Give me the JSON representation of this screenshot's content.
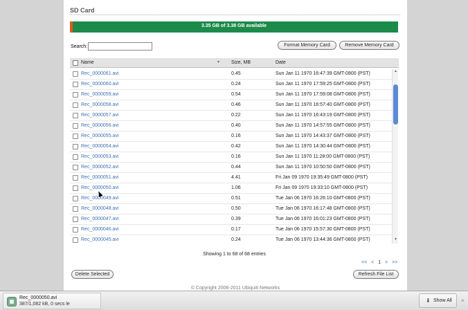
{
  "sd_card": {
    "title": "SD Card",
    "capacity_text": "3.35 GB of 3.38 GB available",
    "capacity_used_fraction": 0.009
  },
  "search": {
    "label": "Search:",
    "value": ""
  },
  "buttons": {
    "format": "Format Memory Card",
    "remove": "Remove Memory Card",
    "delete": "Delete Selected",
    "refresh": "Refresh File List"
  },
  "table": {
    "headers": {
      "name": "Name",
      "size": "Size, MB",
      "date": "Date"
    },
    "rows": [
      {
        "name": "Rec_0000061.avi",
        "size": "0.45",
        "date": "Sun Jan 11 1970 16:47:39 GMT-0800 (PST)"
      },
      {
        "name": "Rec_0000060.avi",
        "size": "0.24",
        "date": "Sun Jan 11 1970 17:59:25 GMT-0800 (PST)"
      },
      {
        "name": "Rec_0000059.avi",
        "size": "0.54",
        "date": "Sun Jan 11 1970 17:59:08 GMT-0800 (PST)"
      },
      {
        "name": "Rec_0000058.avi",
        "size": "0.46",
        "date": "Sun Jan 11 1970 16:57:40 GMT-0800 (PST)"
      },
      {
        "name": "Rec_0000057.avi",
        "size": "0.22",
        "date": "Sun Jan 11 1970 16:43:19 GMT-0800 (PST)"
      },
      {
        "name": "Rec_0000056.avi",
        "size": "0.40",
        "date": "Sun Jan 11 1970 14:57:55 GMT-0800 (PST)"
      },
      {
        "name": "Rec_0000055.avi",
        "size": "0.16",
        "date": "Sun Jan 11 1970 14:43:37 GMT-0800 (PST)"
      },
      {
        "name": "Rec_0000054.avi",
        "size": "0.42",
        "date": "Sun Jan 11 1970 14:30:44 GMT-0800 (PST)"
      },
      {
        "name": "Rec_0000053.avi",
        "size": "0.16",
        "date": "Sun Jan 11 1970 11:28:00 GMT-0800 (PST)"
      },
      {
        "name": "Rec_0000052.avi",
        "size": "0.44",
        "date": "Sun Jan 11 1970 10:50:50 GMT-0800 (PST)"
      },
      {
        "name": "Rec_0000051.avi",
        "size": "4.41",
        "date": "Fri Jan 09 1970 19:35:49 GMT-0800 (PST)"
      },
      {
        "name": "Rec_0000050.avi",
        "size": "1.06",
        "date": "Fri Jan 09 1970 19:33:10 GMT-0800 (PST)"
      },
      {
        "name": "Rec_0000049.avi",
        "size": "0.51",
        "date": "Tue Jan 06 1970 16:26:10 GMT-0800 (PST)"
      },
      {
        "name": "Rec_0000048.avi",
        "size": "0.50",
        "date": "Tue Jan 06 1970 16:17:48 GMT-0800 (PST)"
      },
      {
        "name": "Rec_0000047.avi",
        "size": "0.39",
        "date": "Tue Jan 06 1970 16:01:23 GMT-0800 (PST)"
      },
      {
        "name": "Rec_0000046.avi",
        "size": "0.17",
        "date": "Tue Jan 06 1970 15:57:30 GMT-0800 (PST)"
      },
      {
        "name": "Rec_0000045.avi",
        "size": "0.24",
        "date": "Tue Jan 06 1970 13:44:36 GMT-0800 (PST)"
      }
    ]
  },
  "footer": {
    "showing": "Showing 1 to 68 of 68 entries",
    "pager": {
      "first": "<<",
      "prev": "<",
      "current": "1",
      "next": ">",
      "last": ">>"
    },
    "copyright": "© Copyright 2006-2011 Ubiquiti Networks"
  },
  "download_bar": {
    "file_name": "Rec_0000050.avi",
    "status": "387/1,082 kB, 0 secs le",
    "show_all": "Show All",
    "close": "×"
  },
  "colors": {
    "capacity_free": "#1c8a4b",
    "capacity_used": "#e2571e",
    "link": "#3d6fb5"
  }
}
